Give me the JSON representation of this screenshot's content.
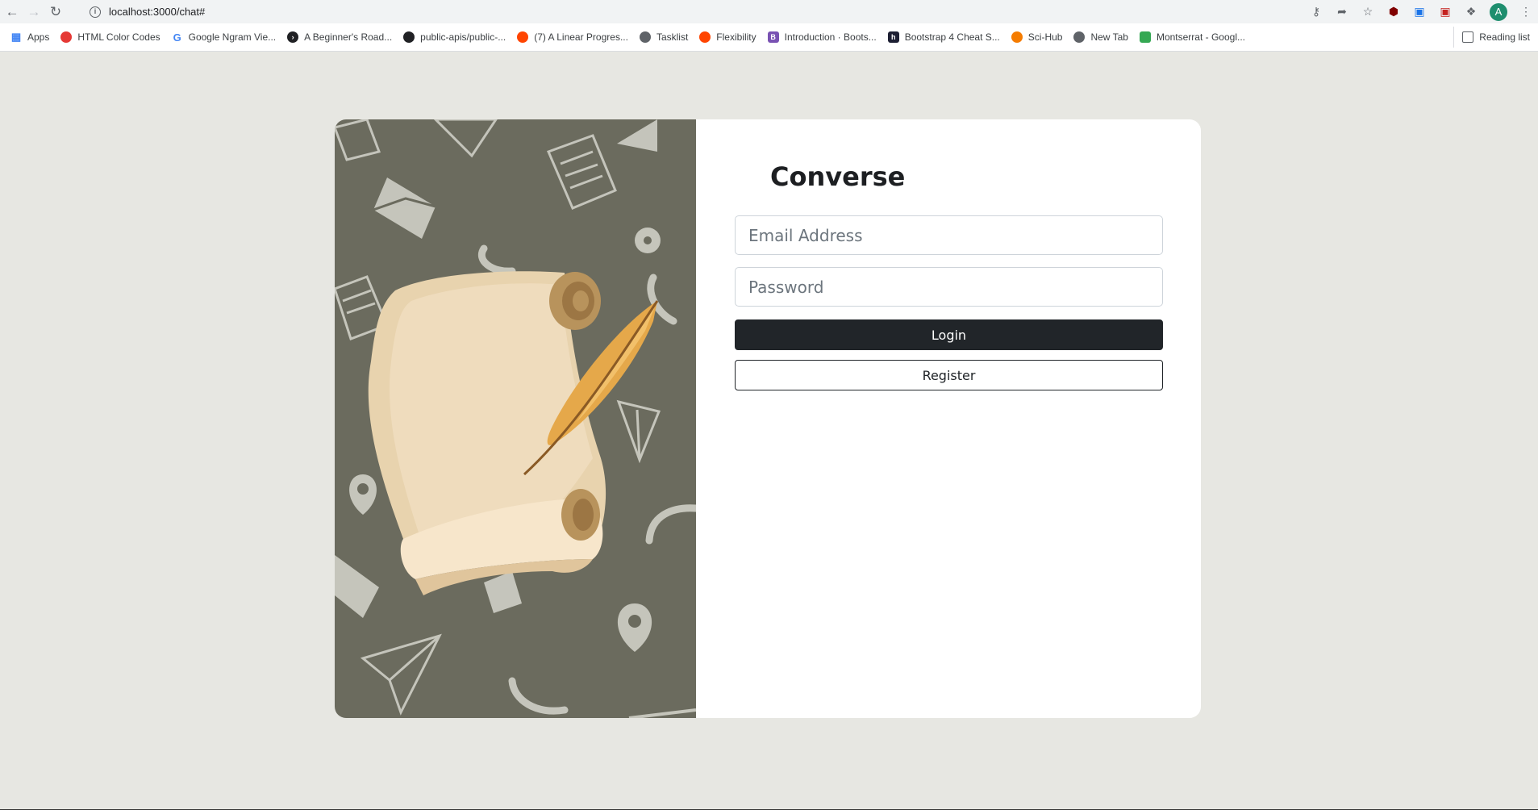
{
  "browser": {
    "url": "localhost:3000/chat#",
    "profile_initial": "A",
    "bookmarks": [
      {
        "label": "Apps",
        "icon": "apps-grid-icon",
        "color": "#4285f4"
      },
      {
        "label": "HTML Color Codes",
        "icon": "color-wheel-icon",
        "color": "#e53935"
      },
      {
        "label": "Google Ngram Vie...",
        "icon": "google-icon",
        "color": "#4285f4"
      },
      {
        "label": "A Beginner's Road...",
        "icon": "terminal-icon",
        "color": "#202124"
      },
      {
        "label": "public-apis/public-...",
        "icon": "github-icon",
        "color": "#202124"
      },
      {
        "label": "(7) A Linear Progres...",
        "icon": "reddit-icon",
        "color": "#ff4500"
      },
      {
        "label": "Tasklist",
        "icon": "globe-icon",
        "color": "#5f6368"
      },
      {
        "label": "Flexibility",
        "icon": "reddit-icon",
        "color": "#ff4500"
      },
      {
        "label": "Introduction · Boots...",
        "icon": "bootstrap-icon",
        "color": "#7952b3"
      },
      {
        "label": "Bootstrap 4 Cheat S...",
        "icon": "hackerrank-icon",
        "color": "#1d1f33"
      },
      {
        "label": "Sci-Hub",
        "icon": "scihub-icon",
        "color": "#f57c00"
      },
      {
        "label": "New Tab",
        "icon": "globe-icon",
        "color": "#5f6368"
      },
      {
        "label": "Montserrat - Googl...",
        "icon": "google-fonts-icon",
        "color": "#34a853"
      }
    ],
    "reading_list": "Reading list"
  },
  "login": {
    "brand": "Converse",
    "email_placeholder": "Email Address",
    "password_placeholder": "Password",
    "login_label": "Login",
    "register_label": "Register"
  }
}
